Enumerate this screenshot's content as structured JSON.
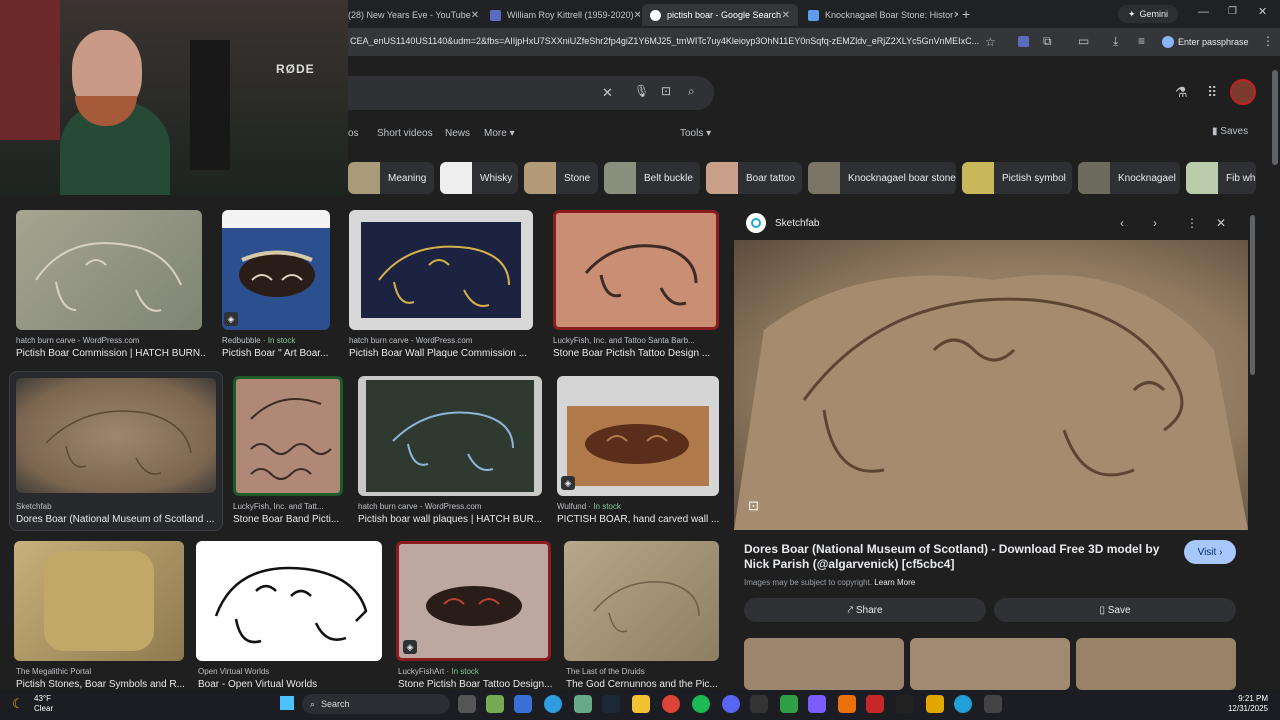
{
  "tabs": [
    {
      "label": "(28) New Years Eve - YouTube",
      "color": "#ff0000",
      "active": false
    },
    {
      "label": "William Roy Kittrell (1959-2020)",
      "color": "#5c6bc0",
      "active": false
    },
    {
      "label": "pictish boar - Google Search",
      "color": "#ffffff",
      "active": true
    },
    {
      "label": "Knocknagael Boar Stone: Histor",
      "color": "#5c9ded",
      "active": false
    }
  ],
  "gemini_label": "Gemini",
  "url": "CEA_enUS1140US1140&udm=2&fbs=AIIjpHxU7SXXniUZfeShr2fp4giZ1Y6MJ25_tmWITc7uy4Kleioyp3OhN11EY0nSqfq-zEMZldv_eRjZ2XLYc5GnVnMEIxC...",
  "passphrase_label": "Enter passphrase",
  "webcam_brand": "RØDE",
  "nav": {
    "partial_tab": "os",
    "short_videos": "Short videos",
    "news": "News",
    "more": "More",
    "tools": "Tools",
    "saves": "Saves"
  },
  "chips": [
    "Meaning",
    "Whisky",
    "Stone",
    "Belt buckle",
    "Boar tattoo",
    "Knocknagael boar stone",
    "Pictish symbol",
    "Knocknagael",
    "Fib wh"
  ],
  "results": [
    {
      "source": "hatch burn carve - WordPress.com",
      "stock": "",
      "title": "Pictish Boar Commission | HATCH BURN..."
    },
    {
      "source": "Redbubble · ",
      "stock": "In stock",
      "title": "Pictish Boar \" Art Boar..."
    },
    {
      "source": "hatch burn carve - WordPress.com",
      "stock": "",
      "title": "Pictish Boar Wall Plaque Commission ..."
    },
    {
      "source": "LuckyFish, Inc. and Tattoo Santa Barb...",
      "stock": "",
      "title": "Stone Boar Pictish Tattoo Design ..."
    },
    {
      "source": "Sketchfab",
      "stock": "",
      "title": "Dores Boar (National Museum of Scotland ..."
    },
    {
      "source": "LuckyFish, Inc. and Tatt...",
      "stock": "",
      "title": "Stone Boar Band Picti..."
    },
    {
      "source": "hatch burn carve - WordPress.com",
      "stock": "",
      "title": "Pictish boar wall plaques | HATCH BUR..."
    },
    {
      "source": "Wulfund · ",
      "stock": "In stock",
      "title": "PICTISH BOAR, hand carved wall ..."
    },
    {
      "source": "The Megalithic Portal",
      "stock": "",
      "title": "Pictish Stones, Boar Symbols and R..."
    },
    {
      "source": "Open Virtual Worlds",
      "stock": "",
      "title": "Boar - Open Virtual Worlds"
    },
    {
      "source": "LuckyFishArt · ",
      "stock": "In stock",
      "title": "Stone Pictish Boar Tattoo Design..."
    },
    {
      "source": "The Last of the Druids",
      "stock": "",
      "title": "The God Cernunnos and the Pic..."
    }
  ],
  "panel": {
    "source": "Sketchfab",
    "title": "Dores Boar (National Museum of Scotland) - Download Free 3D model by Nick Parish (@algarvenick) [cf5cbc4]",
    "copyright": "Images may be subject to copyright.",
    "learn_more": "Learn More",
    "visit": "Visit",
    "share": "Share",
    "save": "Save"
  },
  "taskbar": {
    "temp": "43°F",
    "weather": "Clear",
    "search": "Search",
    "time": "9:21 PM",
    "date": "12/31/2025"
  }
}
